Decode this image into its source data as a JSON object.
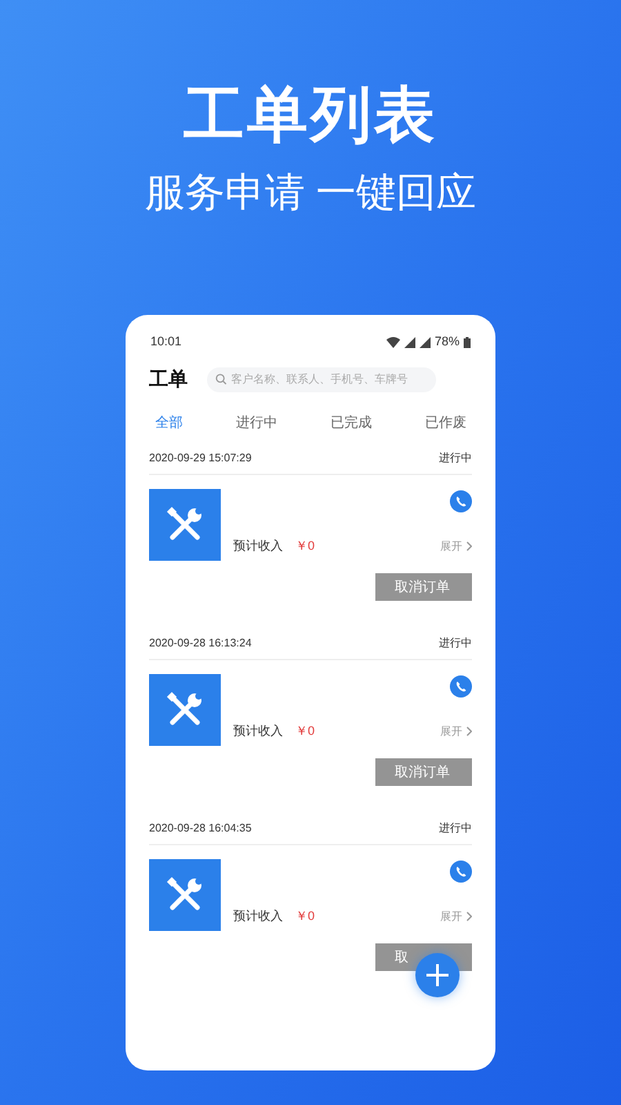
{
  "headline": "工单列表",
  "subheadline": "服务申请 一键回应",
  "status_bar": {
    "time": "10:01",
    "battery": "78%"
  },
  "page_title": "工单",
  "search": {
    "placeholder": "客户名称、联系人、手机号、车牌号"
  },
  "tabs": [
    {
      "label": "全部",
      "selected": true
    },
    {
      "label": "进行中",
      "selected": false
    },
    {
      "label": "已完成",
      "selected": false
    },
    {
      "label": "已作废",
      "selected": false
    }
  ],
  "orders": [
    {
      "time": "2020-09-29 15:07:29",
      "status": "进行中",
      "income_label": "预计收入",
      "income": "￥0",
      "expand": "展开",
      "action": "取消订单"
    },
    {
      "time": "2020-09-28 16:13:24",
      "status": "进行中",
      "income_label": "预计收入",
      "income": "￥0",
      "expand": "展开",
      "action": "取消订单"
    },
    {
      "time": "2020-09-28 16:04:35",
      "status": "进行中",
      "income_label": "预计收入",
      "income": "￥0",
      "expand": "展开",
      "action": "取"
    }
  ]
}
